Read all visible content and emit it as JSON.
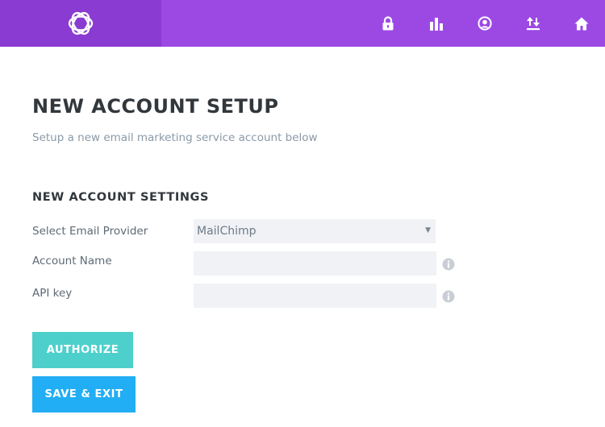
{
  "colors": {
    "header_bg": "#9c49e4",
    "brand_bg": "#8a3bd1",
    "authorize_button": "#4dd0cc",
    "save_button": "#22aef5",
    "field_bg": "#f0f2f6"
  },
  "header": {
    "logo_icon": "bloom-logo-icon",
    "nav_icons": [
      "lock-icon",
      "bar-chart-icon",
      "user-circle-icon",
      "import-export-icon",
      "home-icon"
    ]
  },
  "main": {
    "title": "NEW ACCOUNT SETUP",
    "subtitle": "Setup a new email marketing service account below"
  },
  "settings": {
    "section_title": "NEW ACCOUNT SETTINGS",
    "provider": {
      "label": "Select Email Provider",
      "value": "MailChimp",
      "arrow": "▼"
    },
    "account_name": {
      "label": "Account Name",
      "value": "",
      "info_icon": "info-icon"
    },
    "api_key": {
      "label": "API key",
      "value": "",
      "info_icon": "info-icon"
    }
  },
  "actions": {
    "authorize_label": "AUTHORIZE",
    "save_label": "SAVE & EXIT"
  }
}
